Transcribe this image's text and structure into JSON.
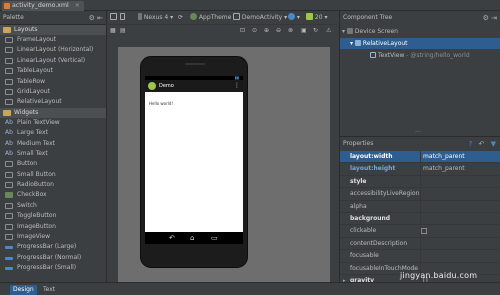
{
  "file_tab": {
    "label": "activity_demo.xml",
    "close": "×"
  },
  "palette": {
    "title": "Palette",
    "groups": [
      {
        "label": "Layouts",
        "items": [
          "FrameLayout",
          "LinearLayout (Horizontal)",
          "LinearLayout (Vertical)",
          "TableLayout",
          "TableRow",
          "GridLayout",
          "RelativeLayout"
        ]
      },
      {
        "label": "Widgets",
        "items": [
          "Plain TextView",
          "Large Text",
          "Medium Text",
          "Small Text",
          "Button",
          "Small Button",
          "RadioButton",
          "CheckBox",
          "Switch",
          "ToggleButton",
          "ImageButton",
          "ImageView",
          "ProgressBar (Large)",
          "ProgressBar (Normal)",
          "ProgressBar (Small)"
        ]
      }
    ]
  },
  "toolbar": {
    "device": "Nexus 4",
    "theme": "AppTheme",
    "activity": "DemoActivity",
    "api": "20"
  },
  "phone": {
    "app_title": "Demo",
    "menu": "⋮",
    "hello_text": "Hello world!",
    "nav_back": "↶",
    "nav_home": "⌂",
    "nav_recent": "▭"
  },
  "component_tree": {
    "title": "Component Tree",
    "device_screen": "Device Screen",
    "relative_layout": "RelativeLayout",
    "textview": "TextView",
    "textview_value": "- @string/hello_world",
    "more": "..."
  },
  "properties": {
    "title": "Properties",
    "rows": [
      {
        "name": "layout:width",
        "value": "match_parent"
      },
      {
        "name": "layout:height",
        "value": "match_parent"
      },
      {
        "name": "style",
        "value": ""
      },
      {
        "name": "accessibilityLiveRegion",
        "value": ""
      },
      {
        "name": "alpha",
        "value": ""
      },
      {
        "name": "background",
        "value": ""
      },
      {
        "name": "clickable",
        "value": ""
      },
      {
        "name": "contentDescription",
        "value": ""
      },
      {
        "name": "focusable",
        "value": ""
      },
      {
        "name": "focusableInTouchMode",
        "value": ""
      },
      {
        "name": "gravity",
        "value": "[]"
      }
    ]
  },
  "bottom_tabs": {
    "design": "Design",
    "text": "Text"
  },
  "watermark": "jingyan.baidu.com",
  "colors": {
    "accent": "#2d5e8f",
    "panel": "#3c3f41",
    "android_green": "#9fc54b"
  }
}
